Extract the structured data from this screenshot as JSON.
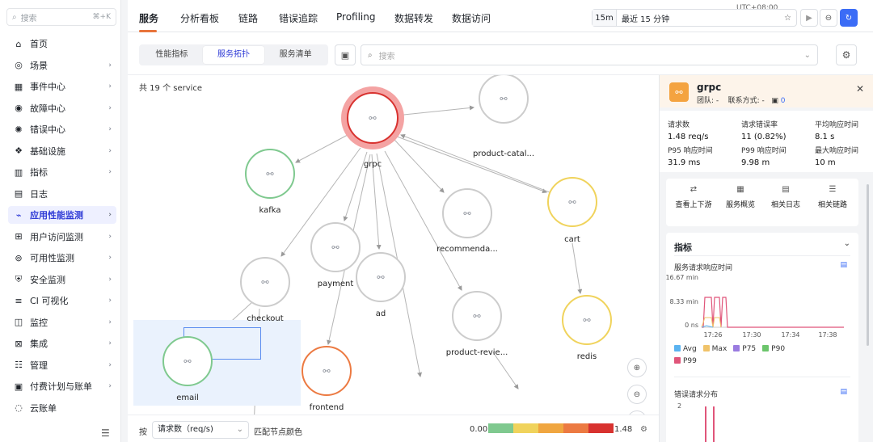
{
  "sidebar": {
    "search_placeholder": "搜索",
    "search_shortcut": "⌘+K",
    "items": [
      {
        "label": "首页",
        "icon": "home-icon"
      },
      {
        "label": "场景",
        "icon": "scene-icon"
      },
      {
        "label": "事件中心",
        "icon": "event-icon"
      },
      {
        "label": "故障中心",
        "icon": "fault-icon"
      },
      {
        "label": "错误中心",
        "icon": "bug-icon"
      },
      {
        "label": "基础设施",
        "icon": "infra-icon"
      },
      {
        "label": "指标",
        "icon": "metric-icon"
      },
      {
        "label": "日志",
        "icon": "log-icon"
      },
      {
        "label": "应用性能监测",
        "icon": "apm-icon"
      },
      {
        "label": "用户访问监测",
        "icon": "rum-icon"
      },
      {
        "label": "可用性监测",
        "icon": "availability-icon"
      },
      {
        "label": "安全监测",
        "icon": "security-icon"
      },
      {
        "label": "CI 可视化",
        "icon": "ci-icon"
      },
      {
        "label": "监控",
        "icon": "monitor-icon"
      },
      {
        "label": "集成",
        "icon": "integration-icon"
      },
      {
        "label": "管理",
        "icon": "manage-icon"
      },
      {
        "label": "付费计划与账单",
        "icon": "billing-icon"
      },
      {
        "label": "云账单",
        "icon": "cloud-bill-icon"
      }
    ],
    "active_index": 8
  },
  "topbar": {
    "tabs": [
      "服务",
      "分析看板",
      "链路",
      "错误追踪",
      "Profiling",
      "数据转发",
      "数据访问"
    ],
    "timezone": "UTC+08:00",
    "quick": "15m",
    "range": "最近 15 分钟"
  },
  "toolbar": {
    "segments": [
      "性能指标",
      "服务拓扑",
      "服务清单"
    ],
    "search_placeholder": "搜索"
  },
  "topology": {
    "count": "共 19 个 service",
    "nodes": [
      {
        "label": "grpc"
      },
      {
        "label": "product-catal..."
      },
      {
        "label": "kafka"
      },
      {
        "label": "recommenda..."
      },
      {
        "label": "cart"
      },
      {
        "label": "payment"
      },
      {
        "label": "ad"
      },
      {
        "label": "checkout"
      },
      {
        "label": "product-revie..."
      },
      {
        "label": "redis"
      },
      {
        "label": "email"
      },
      {
        "label": "frontend"
      }
    ],
    "footer_by": "按",
    "footer_select": "请求数（req/s)",
    "footer_color": "匹配节点颜色",
    "scale_min": "0.00",
    "scale_max": "1.48",
    "colors": [
      "#7fc98f",
      "#f0d35c",
      "#f0a640",
      "#ec7a42",
      "#d8322f"
    ]
  },
  "panel": {
    "service": "grpc",
    "team": "团队: -",
    "contact": "联系方式: -",
    "owner_count": "0",
    "stats": [
      {
        "label": "请求数",
        "value": "1.48 req/s"
      },
      {
        "label": "请求错误率",
        "value": "11 (0.82%)"
      },
      {
        "label": "平均响应时间",
        "value": "8.1  s"
      },
      {
        "label": "P95 响应时间",
        "value": "31.9  ms"
      },
      {
        "label": "P99 响应时间",
        "value": "9.98  m"
      },
      {
        "label": "最大响应时间",
        "value": "10  m"
      }
    ],
    "actions": [
      "查看上下游",
      "服务概览",
      "相关日志",
      "相关链路"
    ],
    "metrics_title": "指标",
    "chart1_title": "服务请求响应时间",
    "chart1_y": [
      "16.67 min",
      "8.33 min",
      "0 ns"
    ],
    "chart1_x": [
      "17:26",
      "17:30",
      "17:34",
      "17:38"
    ],
    "legend": [
      {
        "name": "Avg",
        "color": "#5bb3f0"
      },
      {
        "name": "Max",
        "color": "#f0c36a"
      },
      {
        "name": "P75",
        "color": "#9a7be0"
      },
      {
        "name": "P90",
        "color": "#6cc56c"
      },
      {
        "name": "P99",
        "color": "#e0557a"
      }
    ],
    "chart2_title": "错误请求分布",
    "chart2_y": "2"
  }
}
